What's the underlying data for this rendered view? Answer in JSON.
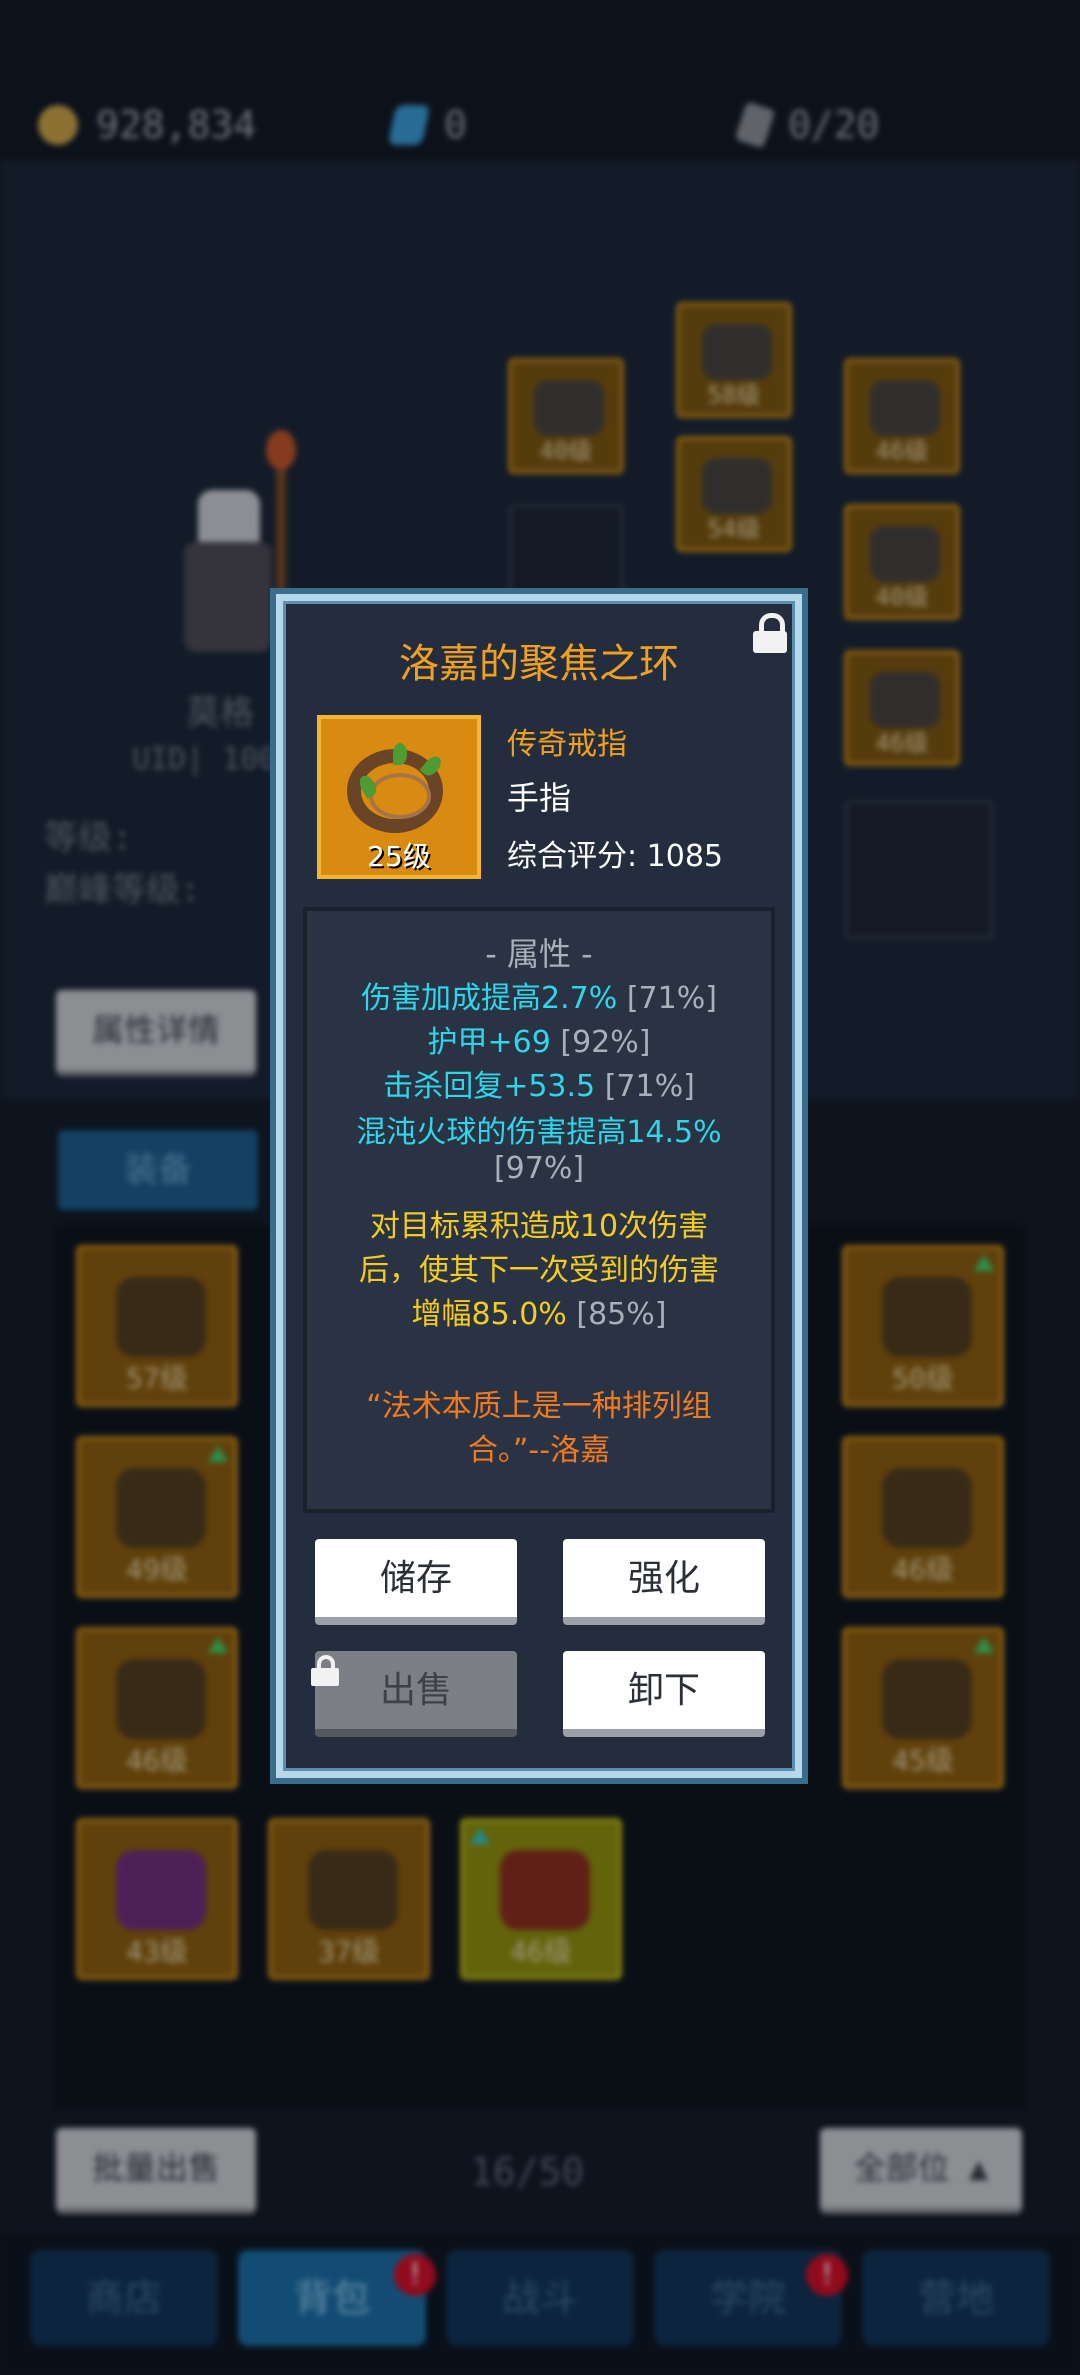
{
  "header": {
    "gold": "928,834",
    "gems": "0",
    "scrolls": "0/20"
  },
  "character": {
    "name": "莫格",
    "uid": "UID| 100",
    "level_label": "等级:",
    "peak_level_label": "巅峰等级:",
    "attr_detail_button": "属性详情"
  },
  "equipped_slot_levels": [
    "40级",
    "58级",
    "46级",
    "54级",
    "40级",
    "46级"
  ],
  "inventory": {
    "tab_label": "装备",
    "items": [
      {
        "level": "57级",
        "upgrade": false
      },
      {
        "level": "50级",
        "upgrade": true
      },
      {
        "level": "49级",
        "upgrade": true
      },
      {
        "level": "46级",
        "upgrade": false
      },
      {
        "level": "46级",
        "upgrade": true
      },
      {
        "level": "45级",
        "upgrade": true
      },
      {
        "level": "43级",
        "upgrade": false
      },
      {
        "level": "37级",
        "upgrade": false
      },
      {
        "level": "46级",
        "upgrade": true
      }
    ],
    "bulk_sell_button": "批量出售",
    "page_count": "16/50",
    "filter_button": "全部位"
  },
  "bottom_nav": [
    {
      "label": "商店"
    },
    {
      "label": "背包",
      "badge": "!"
    },
    {
      "label": "战斗"
    },
    {
      "label": "学院",
      "badge": "!"
    },
    {
      "label": "营地"
    }
  ],
  "item_popup": {
    "title": "洛嘉的聚焦之环",
    "level": "25级",
    "rarity": "传奇戒指",
    "slot": "手指",
    "score": "综合评分: 1085",
    "attributes_header": "- 属性 -",
    "attributes": [
      {
        "text": "伤害加成提高2.7%",
        "pct": "[71%]"
      },
      {
        "text": "护甲+69",
        "pct": "[92%]"
      },
      {
        "text": "击杀回复+53.5",
        "pct": "[71%]"
      },
      {
        "text": "混沌火球的伤害提高14.5%",
        "pct": "[97%]"
      }
    ],
    "special_lines": [
      "对目标累积造成10次伤害",
      "后，使其下一次受到的伤害"
    ],
    "special_last": "增幅85.0%",
    "special_pct": "[85%]",
    "flavor_lines": [
      "“法术本质上是一种排列组",
      "合。”--洛嘉"
    ],
    "buttons": {
      "store": "储存",
      "enhance": "强化",
      "sell": "出售",
      "unequip": "卸下"
    }
  },
  "colors": {
    "legendary": "#f0a020",
    "stat": "#2fd6ea",
    "special": "#f2cc22",
    "flavor": "#f07a20",
    "frame": "#b6d8ea"
  }
}
